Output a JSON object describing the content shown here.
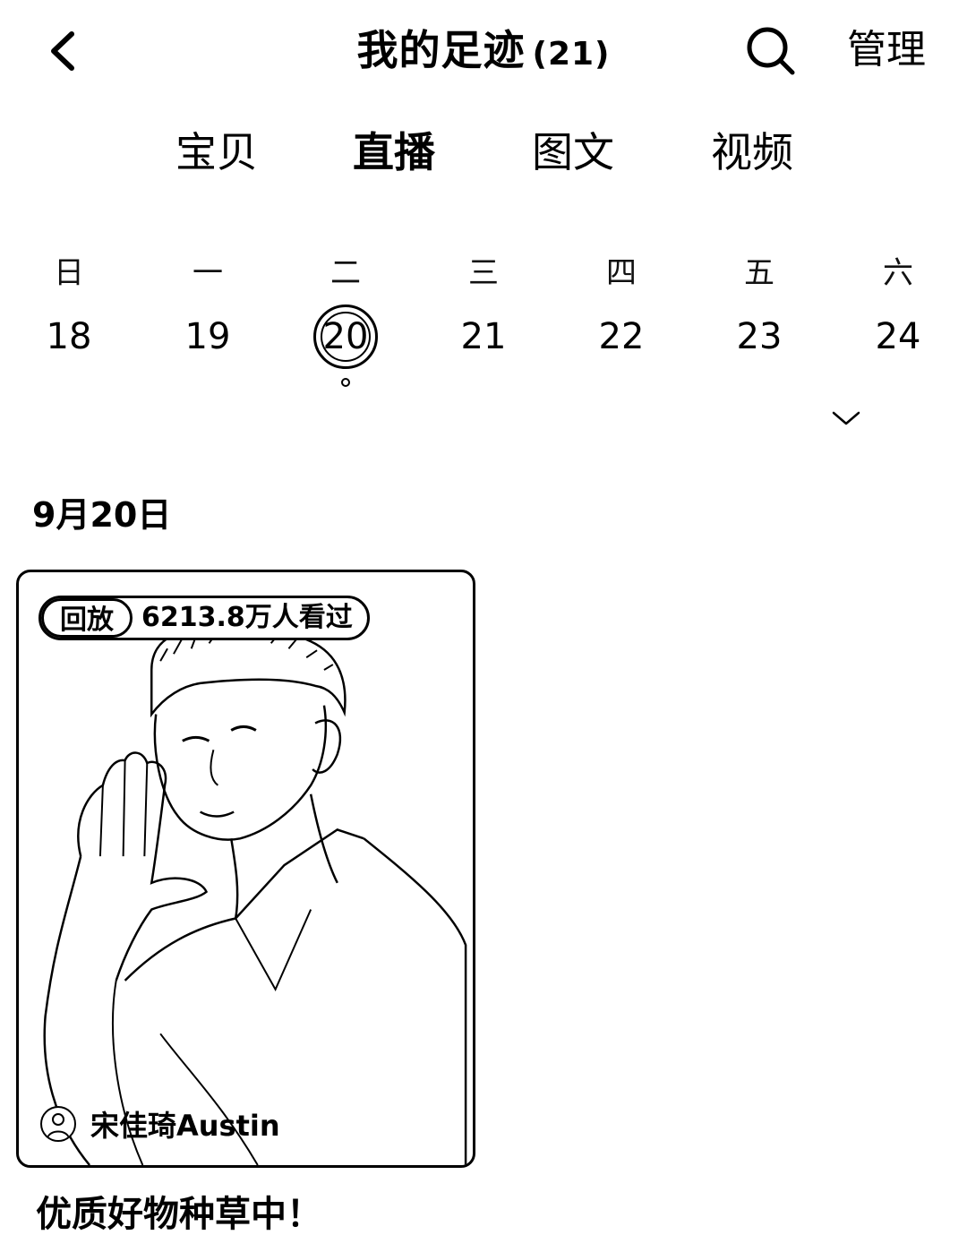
{
  "header": {
    "title": "我的足迹",
    "count": "(21)",
    "manage_label": "管理"
  },
  "tabs": [
    {
      "label": "宝贝",
      "active": false
    },
    {
      "label": "直播",
      "active": true
    },
    {
      "label": "图文",
      "active": false
    },
    {
      "label": "视频",
      "active": false
    }
  ],
  "calendar": {
    "weekdays": [
      "日",
      "一",
      "二",
      "三",
      "四",
      "五",
      "六"
    ],
    "days": [
      "18",
      "19",
      "20",
      "21",
      "22",
      "23",
      "24"
    ],
    "selected_day": "20"
  },
  "section": {
    "date_heading": "9月20日"
  },
  "card": {
    "tag": "回放",
    "views": "6213.8万人看过",
    "author": "宋佳琦Austin",
    "caption": "优质好物种草中！"
  },
  "icons": {
    "back": "chevron-left-icon",
    "search": "search-icon",
    "expand": "chevron-down-icon"
  }
}
